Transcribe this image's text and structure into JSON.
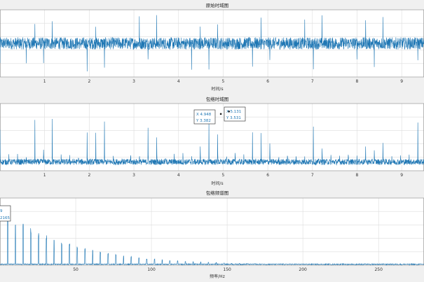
{
  "chart_data": [
    {
      "type": "line",
      "title": "原始时域图",
      "xlabel": "时间/s",
      "ylabel": "",
      "xlim": [
        0,
        9.5
      ],
      "xticks": [
        1,
        2,
        3,
        4,
        5,
        6,
        7,
        8,
        9
      ],
      "ylim": [
        -1,
        1
      ],
      "grid": true,
      "color": "#1f77b4",
      "signal": "vibration, baseline noise with periodic impulses",
      "impulse_period_s": 0.195,
      "noise_amplitude": 0.18,
      "impulse_amplitude": 0.85
    },
    {
      "type": "line",
      "title": "包络时域图",
      "xlabel": "时间/s",
      "ylabel": "",
      "xlim": [
        0,
        9.5
      ],
      "xticks": [
        1,
        2,
        3,
        4,
        5,
        6,
        7,
        8,
        9
      ],
      "ylim": [
        0,
        4
      ],
      "grid": true,
      "color": "#1f77b4",
      "impulse_period_s": 0.195,
      "baseline": 0.35,
      "datatips": [
        {
          "x_label": "X 4.948",
          "y_label": "Y 3.382",
          "x": 4.948,
          "y": 3.382
        },
        {
          "x_label": "X 5.131",
          "y_label": "Y 3.531",
          "x": 5.131,
          "y": 3.531
        }
      ]
    },
    {
      "type": "line",
      "title": "包络频谱图",
      "xlabel": "频率/Hz",
      "ylabel": "",
      "xlim": [
        0,
        280
      ],
      "xticks": [
        50,
        100,
        150,
        200,
        250
      ],
      "ylim": [
        0,
        0.28
      ],
      "grid": true,
      "color": "#1f77b4",
      "fundamental_hz": 5.1,
      "peak_amplitude": 0.2165,
      "datatip": {
        "x_label": "9",
        "y_label": "2165"
      }
    }
  ]
}
